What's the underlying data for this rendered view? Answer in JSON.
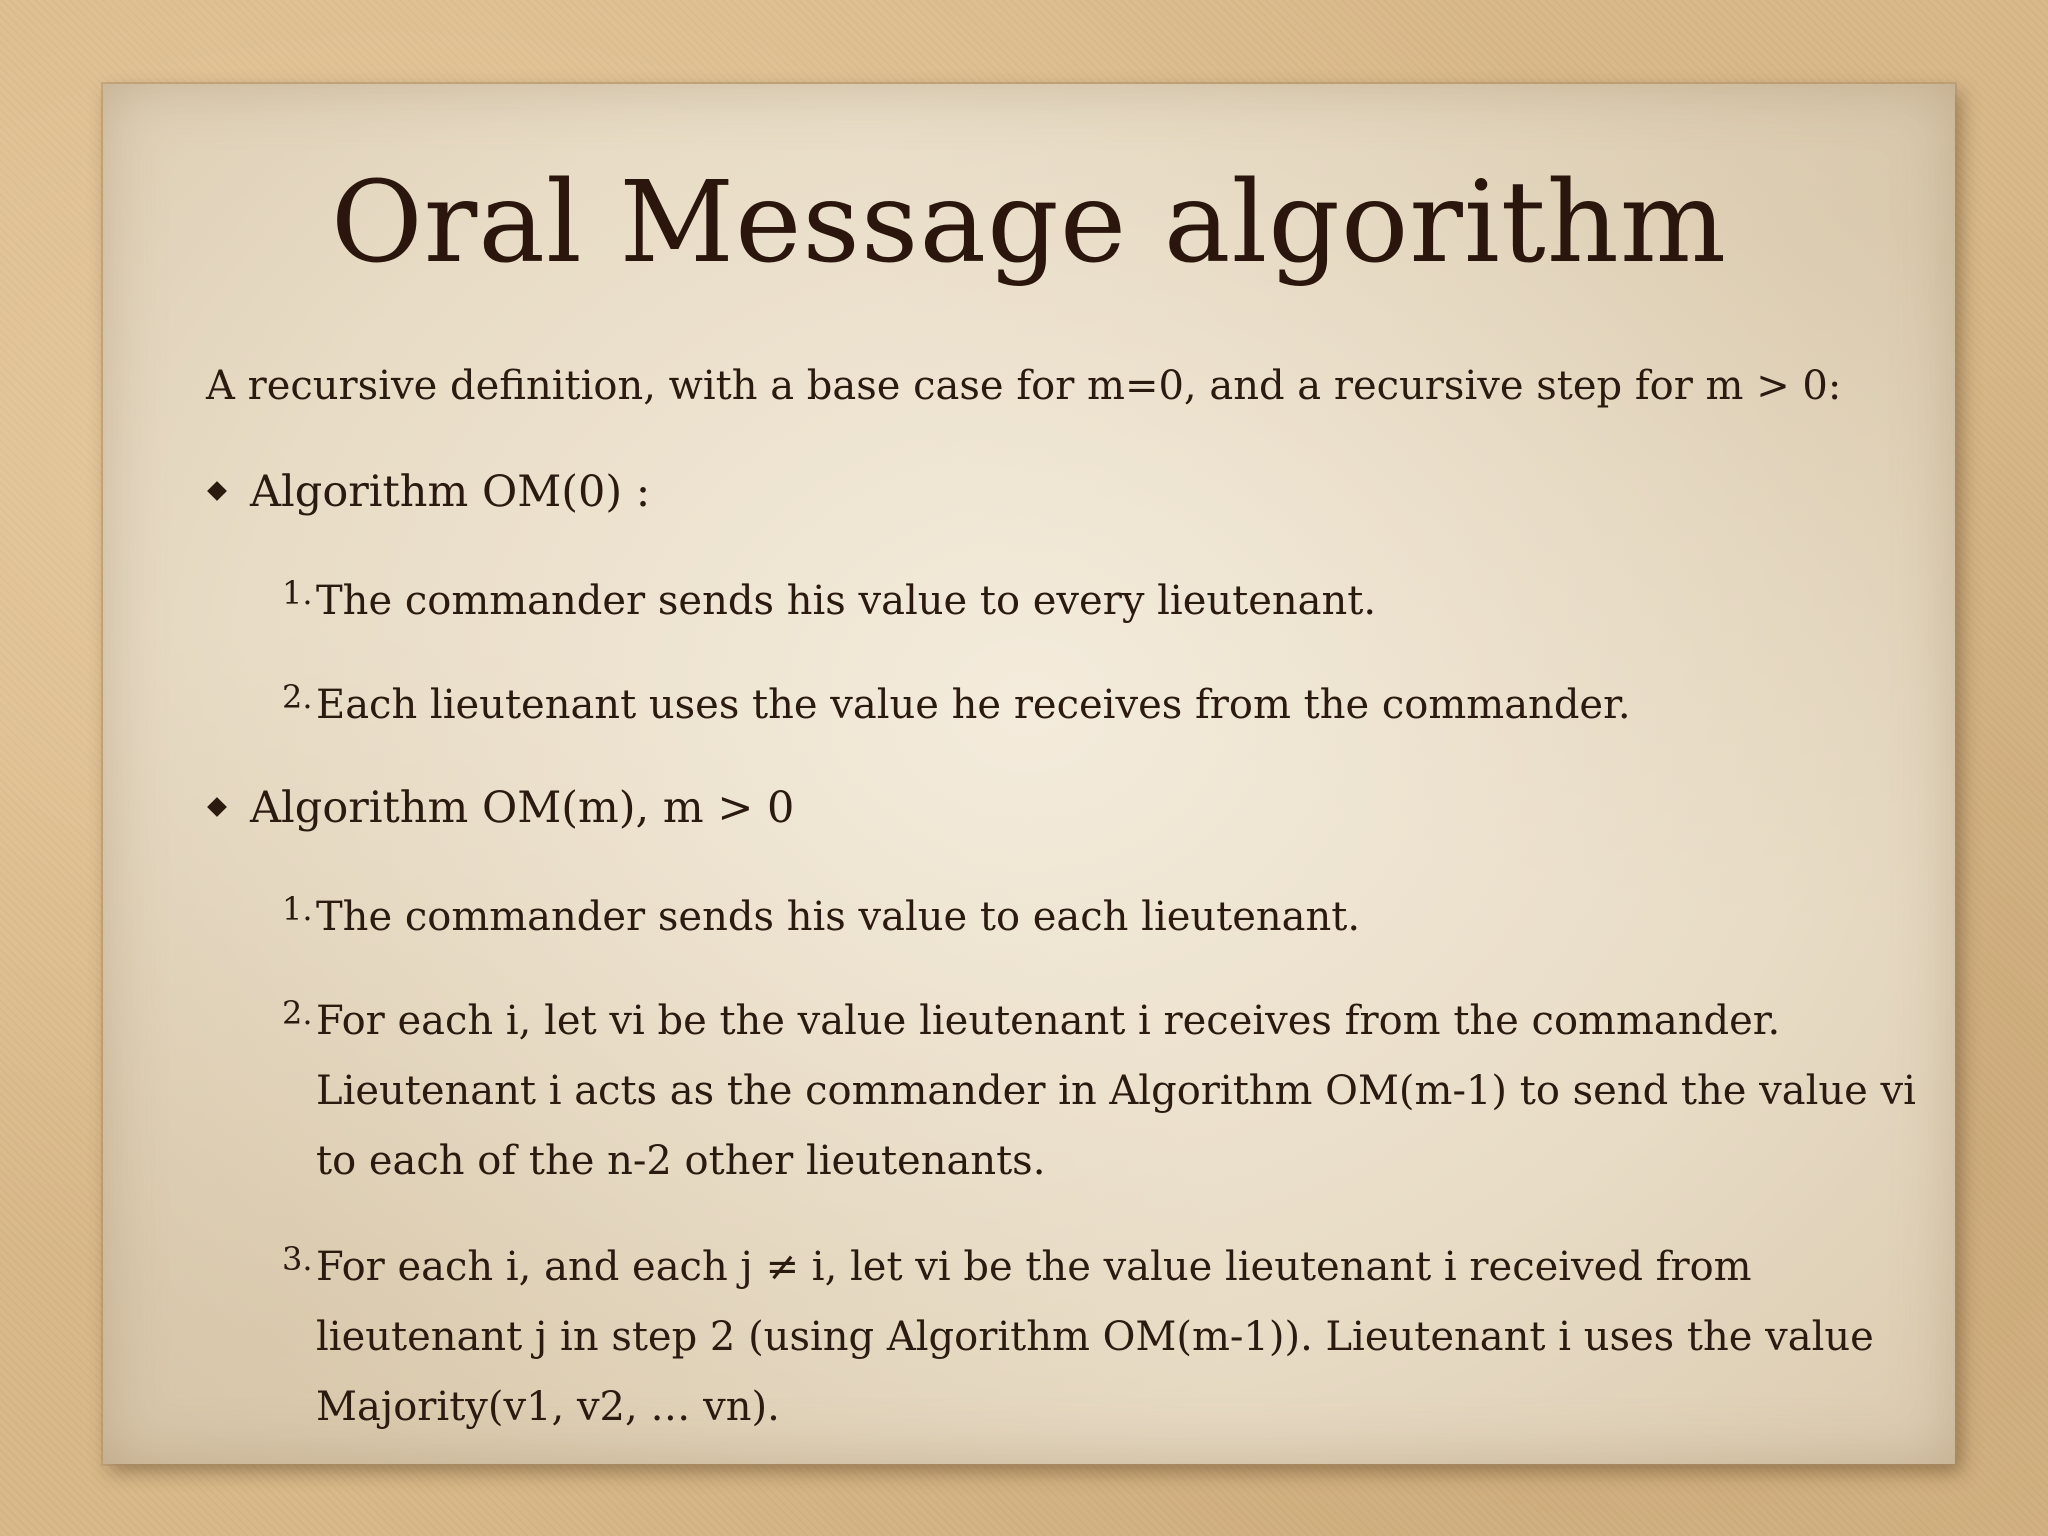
{
  "slide": {
    "title": "Oral Message algorithm",
    "intro": "A recursive definition, with a base case for m=0, and a recursive step for m > 0:",
    "sections": [
      {
        "heading": "Algorithm OM(0) :",
        "steps": [
          {
            "number": "1.",
            "text": "The commander sends his value to every lieutenant."
          },
          {
            "number": "2.",
            "text": "Each lieutenant uses the value he receives from the commander."
          }
        ]
      },
      {
        "heading": "Algorithm OM(m), m > 0",
        "steps": [
          {
            "number": "1.",
            "text": "The commander sends his value to each lieutenant."
          },
          {
            "number": "2.",
            "text": "For each i, let vi be the value lieutenant i receives from the commander. Lieutenant i acts as the commander in Algorithm OM(m-1) to send the value vi to each of the n-2 other lieutenants."
          },
          {
            "number": "3.",
            "text": "For each i, and each j ≠ i, let vi be the value lieutenant i received from lieutenant j in step 2 (using Algorithm OM(m-1)). Lieutenant i uses the value Majority(v1, v2, … vn)."
          }
        ]
      }
    ]
  },
  "colors": {
    "background": "#d9b98a",
    "paper": "#e8dcc6",
    "ink": "#2b1a10"
  }
}
